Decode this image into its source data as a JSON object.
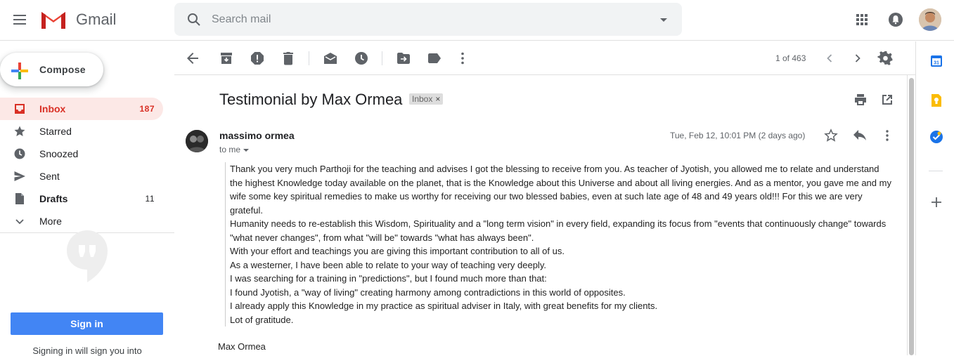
{
  "header": {
    "app_name": "Gmail",
    "search_placeholder": "Search mail"
  },
  "sidebar": {
    "compose_label": "Compose",
    "items": [
      {
        "label": "Inbox",
        "count": "187",
        "icon": "inbox-icon"
      },
      {
        "label": "Starred",
        "count": "",
        "icon": "star-icon"
      },
      {
        "label": "Snoozed",
        "count": "",
        "icon": "clock-icon"
      },
      {
        "label": "Sent",
        "count": "",
        "icon": "send-icon"
      },
      {
        "label": "Drafts",
        "count": "11",
        "icon": "draft-icon"
      },
      {
        "label": "More",
        "count": "",
        "icon": "chevron-down-icon"
      }
    ],
    "signin_label": "Sign in",
    "signin_note": "Signing in will sign you into"
  },
  "toolbar": {
    "pager": "1 of 463"
  },
  "email": {
    "subject": "Testimonial by Max Ormea",
    "label_chip": "Inbox",
    "sender": "massimo ormea",
    "to": "to me",
    "date": "Tue, Feb 12, 10:01 PM (2 days ago)",
    "body": [
      "Thank you very much Parthoji for the teaching and advises I got the blessing to receive from you. As teacher of Jyotish, you allowed me to relate and understand the highest Knowledge today available on the planet, that is the Knowledge about this Universe and about all living energies. And as a mentor, you gave me and my wife some key spiritual remedies to make us worthy for receiving our two blessed babies, even at such late age of 48 and 49 years old!!! For this we are very grateful.",
      "Humanity needs to re-establish this Wisdom, Spirituality and a \"long term vision\" in every field, expanding its focus from \"events that continuously change\" towards \"what never changes\", from what \"will be\" towards \"what has always been\".",
      "With your effort and teachings you are giving this important contribution to all of us.",
      "As a westerner, I have been able to relate to your way of teaching very deeply.",
      "I was searching for a training in \"predictions\", but I found much more than that:",
      "I found Jyotish, a \"way of living\" creating harmony among contradictions in this world of opposites.",
      "I already apply this Knowledge in my practice as spiritual adviser in Italy, with great benefits for my clients.",
      "Lot of gratitude."
    ],
    "signature": "Max Ormea"
  },
  "colors": {
    "accent_red": "#d93025",
    "inbox_bg": "#fce8e6",
    "signin_blue": "#4285f4"
  }
}
